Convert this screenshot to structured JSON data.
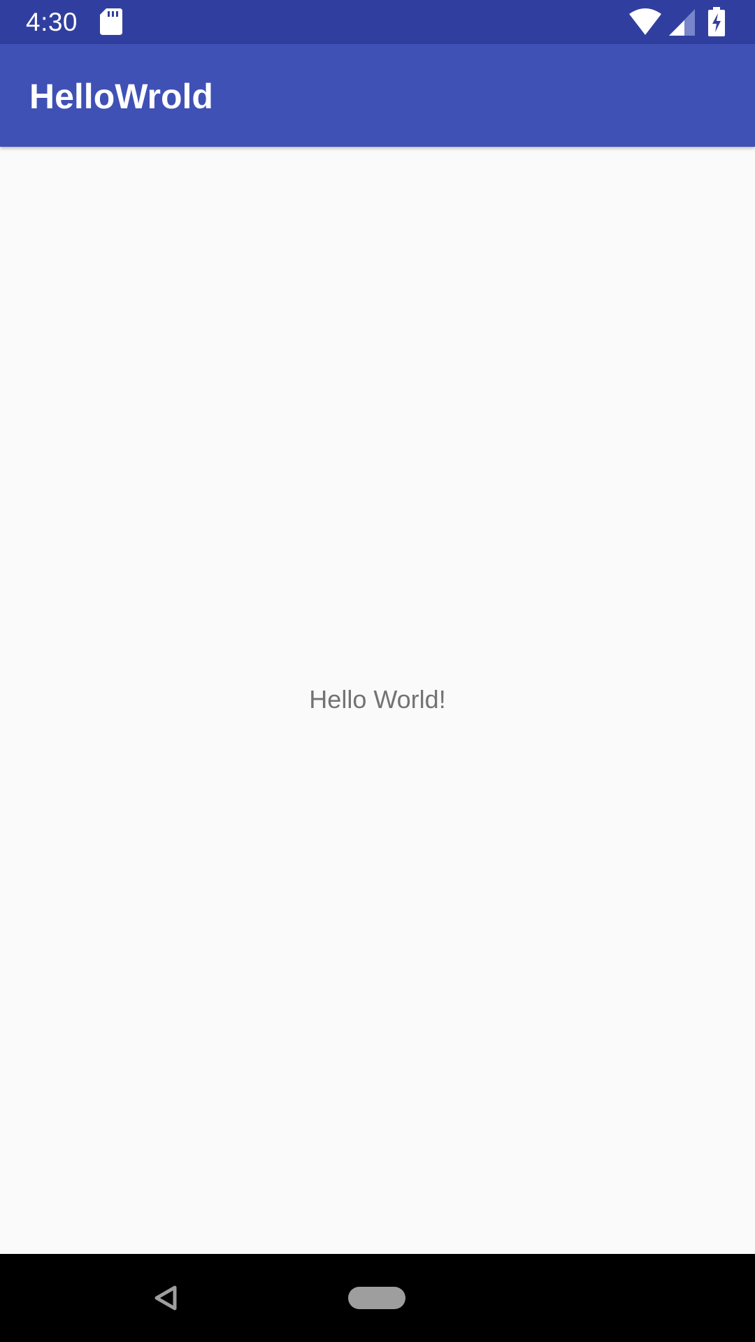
{
  "status_bar": {
    "time": "4:30",
    "icons": [
      "sd-card-icon",
      "wifi-icon",
      "cellular-signal-icon",
      "battery-charging-icon"
    ]
  },
  "app_bar": {
    "title": "HelloWrold"
  },
  "main": {
    "message": "Hello World!"
  },
  "nav_bar": {
    "buttons": [
      "back-icon",
      "home-icon"
    ]
  },
  "colors": {
    "status_bar": "#303f9f",
    "app_bar": "#3f51b5",
    "background": "#fafafa",
    "text": "#737373",
    "nav_bar": "#000000"
  }
}
